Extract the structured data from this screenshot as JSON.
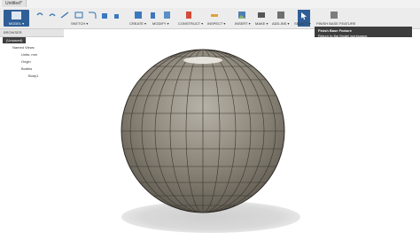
{
  "window": {
    "tab_title": "Untitled*"
  },
  "toolbar": {
    "model_label": "MODEL ▾",
    "groups": [
      "SKETCH ▾",
      "CREATE ▾",
      "MODIFY ▾",
      "CONSTRUCT ▾",
      "INSPECT ▾",
      "INSERT ▾",
      "MAKE ▾",
      "ADD-INS ▾",
      "SELECT ▾",
      "FINISH BASE FEATURE"
    ]
  },
  "tooltip": {
    "title": "Finish Base Feature",
    "description": "Return to the Model workspace."
  },
  "browser": {
    "header": "BROWSER",
    "items": [
      "(Unsaved)",
      "Named Views",
      "Units: mm",
      "Origin",
      "Bodies",
      "Body1"
    ]
  },
  "colors": {
    "accent": "#2f5f96",
    "sphere_base": "#8a8377",
    "sphere_edges": "#3a3630"
  }
}
